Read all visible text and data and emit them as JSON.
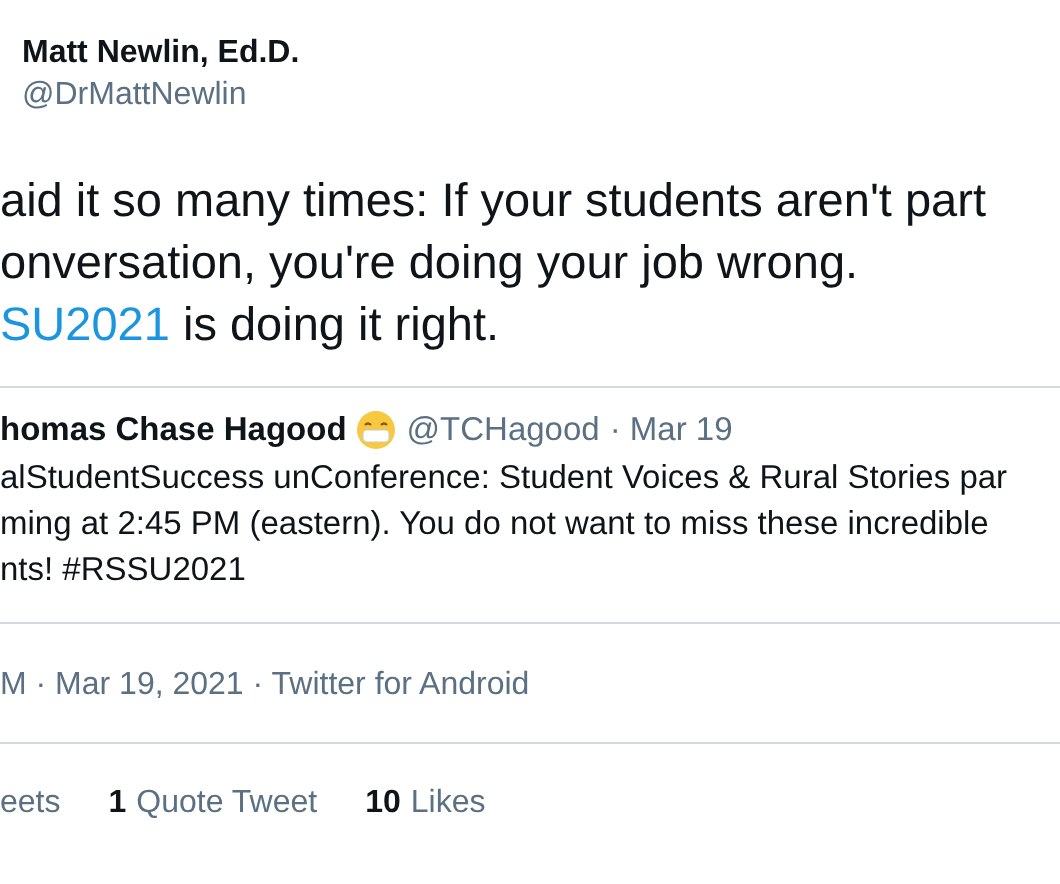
{
  "author": {
    "name": "Matt Newlin, Ed.D.",
    "handle": "@DrMattNewlin"
  },
  "body_lines": [
    [
      {
        "kind": "text",
        "text": "aid it so many times: If your students aren't part"
      }
    ],
    [
      {
        "kind": "text",
        "text": "onversation, you're doing your job wrong."
      }
    ],
    [
      {
        "kind": "hashtag",
        "text": "SU2021"
      },
      {
        "kind": "text",
        "text": " is doing it right."
      }
    ]
  ],
  "quoted_tweet": {
    "name": "homas Chase Hagood",
    "handle": "@TCHagood",
    "date": "· Mar 19",
    "lines": [
      "alStudentSuccess unConference: Student Voices & Rural Stories par",
      "ming at 2:45 PM (eastern). You do not want to miss these incredible",
      "nts! #RSSU2021"
    ]
  },
  "timestamp": "M · Mar 19, 2021 · Twitter for Android",
  "stats": [
    {
      "label": "eets"
    },
    {
      "count": "1",
      "label": "Quote Tweet"
    },
    {
      "count": "10",
      "label": "Likes"
    }
  ]
}
